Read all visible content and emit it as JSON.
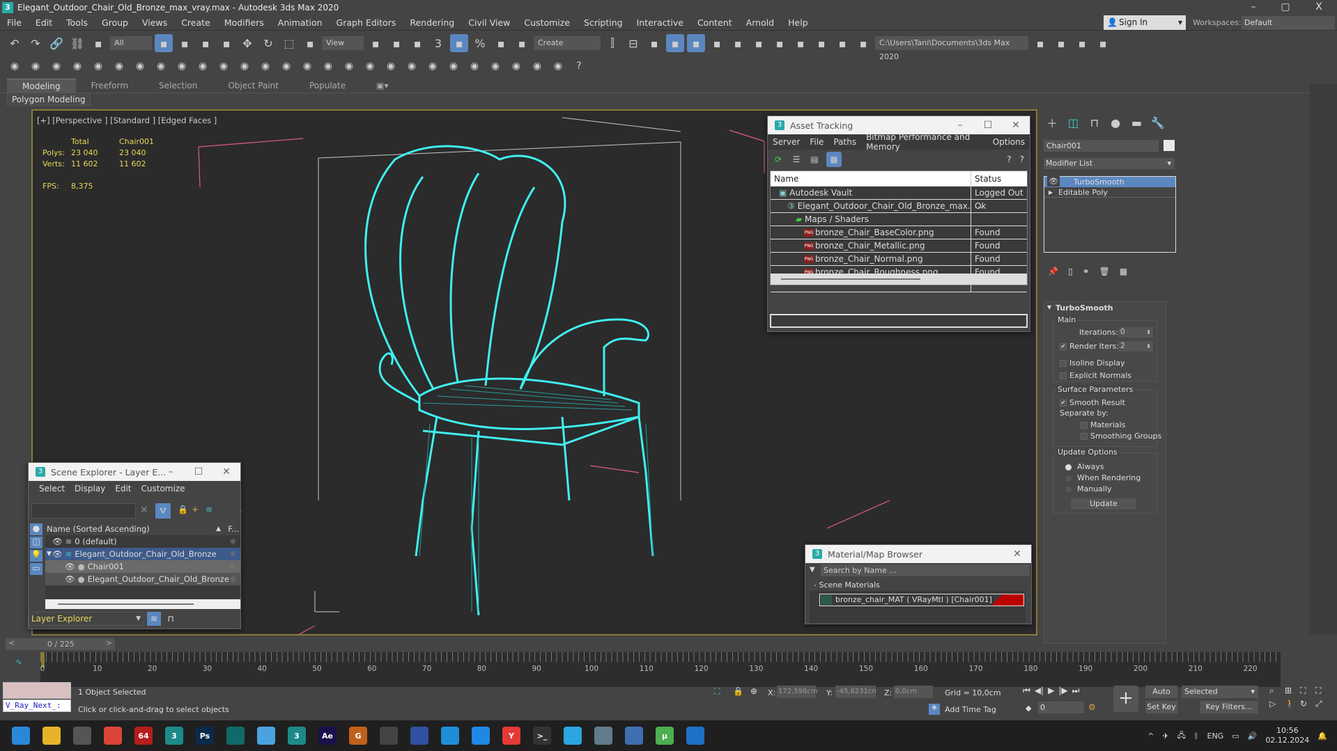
{
  "window": {
    "title": "Elegant_Outdoor_Chair_Old_Bronze_max_vray.max - Autodesk 3ds Max 2020",
    "app_icon": "3",
    "minimize": "–",
    "maximize": "▢",
    "close": "X"
  },
  "menu": [
    "File",
    "Edit",
    "Tools",
    "Group",
    "Views",
    "Create",
    "Modifiers",
    "Animation",
    "Graph Editors",
    "Rendering",
    "Civil View",
    "Customize",
    "Scripting",
    "Interactive",
    "Content",
    "Arnold",
    "Help"
  ],
  "account": {
    "sign_in": "Sign In",
    "workspaces_label": "Workspaces:",
    "workspace": "Default"
  },
  "toolbar1": {
    "selection_filter": "All",
    "ref_coord": "View",
    "named_selection": "Create Selection Se",
    "project_path": "C:\\Users\\Tani\\Documents\\3ds Max 2020",
    "icons": [
      "undo-icon",
      "redo-icon",
      "link-icon",
      "unlink-icon",
      "bind-space-warp-icon",
      "select-object-icon",
      "select-by-name-icon",
      "rect-selection-icon",
      "window-crossing-icon",
      "move-icon",
      "rotate-icon",
      "scale-icon",
      "placement-icon",
      "pivot-icon",
      "manipulate-icon",
      "keyboard-shortcut-icon",
      "snaps-icon",
      "angle-snap-icon",
      "percent-snap-icon",
      "spinner-snap-icon",
      "edit-named-sets-icon",
      "mirror-icon",
      "align-icon",
      "scene-explorer-icon",
      "layer-explorer-icon",
      "ribbon-icon",
      "curve-editor-icon",
      "dope-sheet-icon",
      "schematic-view-icon",
      "material-editor-icon",
      "render-setup-icon",
      "rendered-frame-icon",
      "render-icon",
      "render-cloud-icon",
      "project-folder-icon",
      "project-open-icon",
      "project-structure-icon",
      "project-settings-icon"
    ]
  },
  "toolbar2": {
    "icons": [
      "teapot-icon",
      "cloud-icon",
      "vray-frame-buffer-icon",
      "vray-render-settings-icon",
      "vray-settings-icon",
      "vray-light-lister-icon",
      "vray-camera-icon",
      "vray-physical-camera-icon",
      "vray-debug-icon",
      "vray-plane-light-icon",
      "vray-dome-light-icon",
      "vray-sphere-light-icon",
      "vray-mesh-light-icon",
      "vray-ies-light-icon",
      "vray-sun-icon",
      "vray-ambient-light-icon",
      "vray-proxy-icon",
      "vray-instancer-icon",
      "vray-clipper-icon",
      "vray-fur-icon",
      "vray-fur-grass-icon",
      "vray-hair-icon",
      "vray-displacement-icon",
      "vray-material-icon",
      "vray-material-override-icon",
      "vray-scene-converter-icon",
      "vray-lister-icon",
      "help-icon"
    ]
  },
  "ribbon": {
    "tabs": [
      "Modeling",
      "Freeform",
      "Selection",
      "Object Paint",
      "Populate"
    ],
    "active": "Modeling",
    "panel": "Polygon Modeling"
  },
  "viewport": {
    "label": "[+] [Perspective ] [Standard ] [Edged Faces ]",
    "stats": {
      "col_total": "Total",
      "col_object": "Chair001",
      "polys_label": "Polys:",
      "polys_total": "23 040",
      "polys_object": "23 040",
      "verts_label": "Verts:",
      "verts_total": "11 602",
      "verts_object": "11 602",
      "fps_label": "FPS:",
      "fps": "8,375"
    },
    "wire_color": "#41f0f0",
    "bbox_color": "#e05a8a"
  },
  "asset_tracking": {
    "title": "Asset Tracking",
    "menu": [
      "Server",
      "File",
      "Paths",
      "Bitmap Performance and Memory",
      "Options"
    ],
    "columns": [
      "Name",
      "Status"
    ],
    "rows": [
      {
        "name": "Autodesk Vault",
        "status": "Logged Out ...",
        "icon": "vault-icon",
        "indent": 1
      },
      {
        "name": "Elegant_Outdoor_Chair_Old_Bronze_max...",
        "status": "Ok",
        "icon": "max-file-icon",
        "indent": 2
      },
      {
        "name": "Maps / Shaders",
        "status": "",
        "icon": "maps-icon",
        "indent": 3
      },
      {
        "name": "bronze_Chair_BaseColor.png",
        "status": "Found",
        "icon": "png-icon",
        "indent": 4
      },
      {
        "name": "bronze_Chair_Metallic.png",
        "status": "Found",
        "icon": "png-icon",
        "indent": 4
      },
      {
        "name": "bronze_Chair_Normal.png",
        "status": "Found",
        "icon": "png-icon",
        "indent": 4
      },
      {
        "name": "bronze_Chair_Roughness.png",
        "status": "Found",
        "icon": "png-icon",
        "indent": 4
      }
    ],
    "png_badge": "PNG"
  },
  "scene_explorer": {
    "title": "Scene Explorer - Layer E...",
    "menu": [
      "Select",
      "Display",
      "Edit",
      "Customize"
    ],
    "search": "",
    "column_name": "Name (Sorted Ascending)",
    "column_f": "F...",
    "rows": [
      {
        "name": "0 (default)",
        "level": 0
      },
      {
        "name": "Elegant_Outdoor_Chair_Old_Bronze",
        "level": 0,
        "expanded": true
      },
      {
        "name": "Chair001",
        "level": 1
      },
      {
        "name": "Elegant_Outdoor_Chair_Old_Bronze",
        "level": 1
      }
    ],
    "explorer_type": "Layer Explorer"
  },
  "material_browser": {
    "title": "Material/Map Browser",
    "search_placeholder": "Search by Name ...",
    "group": "- Scene Materials",
    "material": "bronze_chair_MAT  ( VRayMtl )  [Chair001]"
  },
  "command_panel": {
    "object_name": "Chair001",
    "modifier_list": "Modifier List",
    "stack": [
      "TurboSmooth",
      "Editable Poly"
    ],
    "rollout": "TurboSmooth",
    "main": "Main",
    "iterations_label": "Iterations:",
    "iterations": "0",
    "render_iters_label": "Render Iters:",
    "render_iters": "2",
    "render_iters_checked": true,
    "isoline": "Isoline Display",
    "explicit_normals": "Explicit Normals",
    "surface": "Surface Parameters",
    "smooth_result": "Smooth Result",
    "separate_by": "Separate by:",
    "materials": "Materials",
    "smoothing_groups": "Smoothing Groups",
    "update_options": "Update Options",
    "always": "Always",
    "when_rendering": "When Rendering",
    "manually": "Manually",
    "update": "Update"
  },
  "timeline": {
    "frame": "0 / 225",
    "labels": [
      "0",
      "10",
      "20",
      "30",
      "40",
      "50",
      "60",
      "70",
      "80",
      "90",
      "100",
      "110",
      "120",
      "130",
      "140",
      "150",
      "160",
      "170",
      "180",
      "190",
      "200",
      "210",
      "220"
    ]
  },
  "status": {
    "selected": "1 Object Selected",
    "prompt": "Click or click-and-drag to select objects",
    "maxscript": "V_Ray_Next_:",
    "x_label": "X:",
    "x": "172,598cm",
    "y_label": "Y:",
    "y": "-45,6231cm",
    "z_label": "Z:",
    "z": "0,0cm",
    "grid": "Grid = 10,0cm",
    "add_time_tag": "Add Time Tag",
    "current_frame": "0",
    "auto_key": "Auto Key",
    "set_key": "Set Key",
    "key_mode": "Selected",
    "key_filters": "Key Filters..."
  },
  "taskbar": {
    "apps": [
      {
        "name": "windows-start-icon",
        "label": "",
        "color": "#2b88d8"
      },
      {
        "name": "file-explorer-icon",
        "label": "",
        "color": "#e7b32a"
      },
      {
        "name": "task-view-icon",
        "label": "",
        "color": "#555"
      },
      {
        "name": "chrome-icon",
        "label": "",
        "color": "#db4437"
      },
      {
        "name": "app-64-icon",
        "label": "64",
        "color": "#b71c1c"
      },
      {
        "name": "3dsmax-icon",
        "label": "3",
        "color": "#1d8a8a"
      },
      {
        "name": "photoshop-icon",
        "label": "Ps",
        "color": "#0b2a4a"
      },
      {
        "name": "app-teal-icon",
        "label": "",
        "color": "#0f6b6b"
      },
      {
        "name": "notepad-icon",
        "label": "",
        "color": "#4aa3df"
      },
      {
        "name": "3dsmax-active-icon",
        "label": "3",
        "color": "#1d8a8a"
      },
      {
        "name": "after-effects-icon",
        "label": "Ae",
        "color": "#1a0f4a"
      },
      {
        "name": "app-g-icon",
        "label": "G",
        "color": "#c0601a"
      },
      {
        "name": "app-search-icon",
        "label": "",
        "color": "#444"
      },
      {
        "name": "save-app-icon",
        "label": "",
        "color": "#3050a0"
      },
      {
        "name": "edge-icon",
        "label": "",
        "color": "#1e8fd6"
      },
      {
        "name": "app-blue-icon",
        "label": "",
        "color": "#1e88e5"
      },
      {
        "name": "yandex-icon",
        "label": "Y",
        "color": "#e53935"
      },
      {
        "name": "terminal-icon",
        "label": ">_",
        "color": "#333"
      },
      {
        "name": "telegram-icon",
        "label": "",
        "color": "#2ca5e0"
      },
      {
        "name": "calculator-icon",
        "label": "",
        "color": "#607d8b"
      },
      {
        "name": "app-download-icon",
        "label": "",
        "color": "#3f6fb0"
      },
      {
        "name": "utorrent-icon",
        "label": "µ",
        "color": "#4caf50"
      },
      {
        "name": "app-camera-icon",
        "label": "",
        "color": "#1e70c8"
      }
    ],
    "lang": "ENG",
    "time": "10:56",
    "date": "02.12.2024"
  }
}
